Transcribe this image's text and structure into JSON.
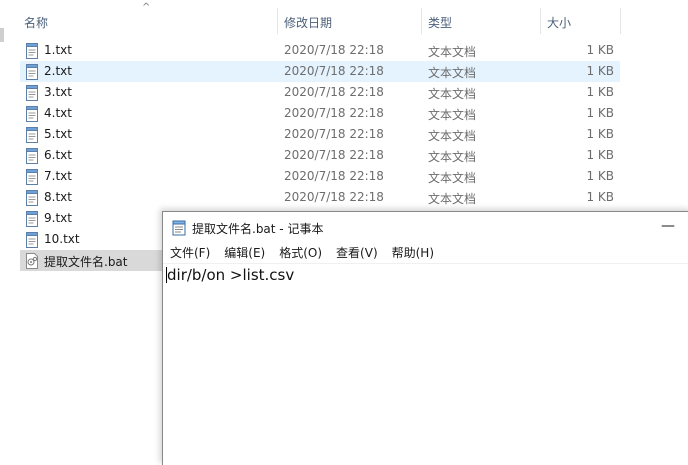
{
  "explorer": {
    "columns": {
      "name": "名称",
      "modified": "修改日期",
      "type": "类型",
      "size": "大小"
    },
    "sort_indicator": "^",
    "files": [
      {
        "name": "1.txt",
        "modified": "2020/7/18 22:18",
        "type": "文本文档",
        "size": "1 KB"
      },
      {
        "name": "2.txt",
        "modified": "2020/7/18 22:18",
        "type": "文本文档",
        "size": "1 KB"
      },
      {
        "name": "3.txt",
        "modified": "2020/7/18 22:18",
        "type": "文本文档",
        "size": "1 KB"
      },
      {
        "name": "4.txt",
        "modified": "2020/7/18 22:18",
        "type": "文本文档",
        "size": "1 KB"
      },
      {
        "name": "5.txt",
        "modified": "2020/7/18 22:18",
        "type": "文本文档",
        "size": "1 KB"
      },
      {
        "name": "6.txt",
        "modified": "2020/7/18 22:18",
        "type": "文本文档",
        "size": "1 KB"
      },
      {
        "name": "7.txt",
        "modified": "2020/7/18 22:18",
        "type": "文本文档",
        "size": "1 KB"
      },
      {
        "name": "8.txt",
        "modified": "2020/7/18 22:18",
        "type": "文本文档",
        "size": "1 KB"
      },
      {
        "name": "9.txt"
      },
      {
        "name": "10.txt"
      },
      {
        "name": "提取文件名.bat"
      }
    ],
    "hover_row_index": 1,
    "selected_row_index": 10
  },
  "notepad": {
    "title": "提取文件名.bat - 记事本",
    "minimize_glyph": "—",
    "menu": [
      "文件(F)",
      "编辑(E)",
      "格式(O)",
      "查看(V)",
      "帮助(H)"
    ],
    "content": "dir/b/on >list.csv"
  },
  "colors": {
    "hover_row": "#e5f3ff",
    "selected_row": "#d9d9d9",
    "header_text": "#4c607a",
    "secondary_text": "#6d6d6d"
  }
}
